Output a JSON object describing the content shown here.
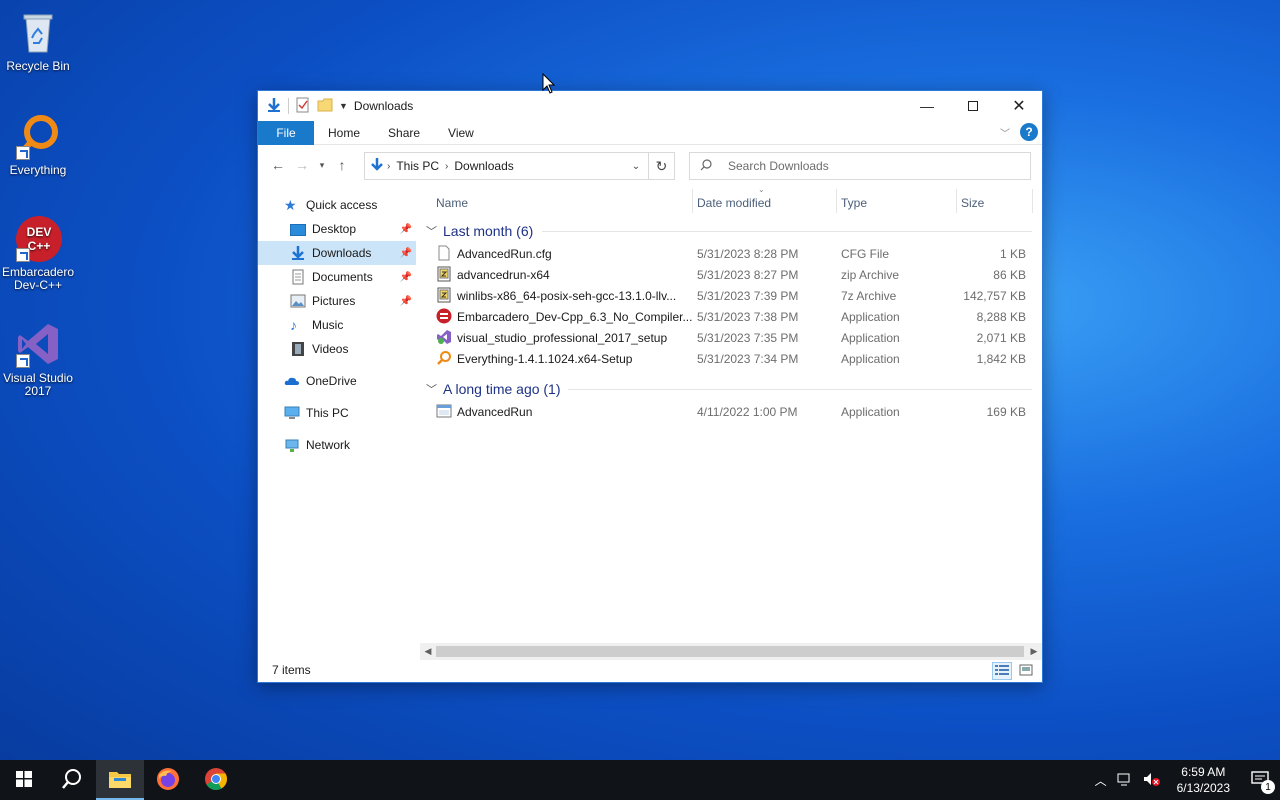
{
  "desktop": {
    "icons": [
      {
        "label": "Recycle Bin"
      },
      {
        "label": "Everything"
      },
      {
        "label": "Embarcadero Dev-C++",
        "badge_line1": "DEV",
        "badge_line2": "C++"
      },
      {
        "label": "Visual Studio 2017"
      }
    ]
  },
  "window": {
    "title": "Downloads",
    "ribbon": {
      "tabs": [
        "File",
        "Home",
        "Share",
        "View"
      ],
      "help": "?"
    },
    "address": {
      "crumbs": [
        "This PC",
        "Downloads"
      ]
    },
    "search": {
      "placeholder": "Search Downloads"
    },
    "sidebar": {
      "items": [
        {
          "label": "Quick access"
        },
        {
          "label": "Desktop"
        },
        {
          "label": "Downloads"
        },
        {
          "label": "Documents"
        },
        {
          "label": "Pictures"
        },
        {
          "label": "Music"
        },
        {
          "label": "Videos"
        },
        {
          "label": "OneDrive"
        },
        {
          "label": "This PC"
        },
        {
          "label": "Network"
        }
      ]
    },
    "columns": {
      "name": "Name",
      "date": "Date modified",
      "type": "Type",
      "size": "Size"
    },
    "groups": [
      {
        "label": "Last month (6)"
      },
      {
        "label": "A long time ago (1)"
      }
    ],
    "files": [
      {
        "name": "AdvancedRun.cfg",
        "date": "5/31/2023 8:28 PM",
        "type": "CFG File",
        "size": "1 KB"
      },
      {
        "name": "advancedrun-x64",
        "date": "5/31/2023 8:27 PM",
        "type": "zip Archive",
        "size": "86 KB"
      },
      {
        "name": "winlibs-x86_64-posix-seh-gcc-13.1.0-llv...",
        "date": "5/31/2023 7:39 PM",
        "type": "7z Archive",
        "size": "142,757 KB"
      },
      {
        "name": "Embarcadero_Dev-Cpp_6.3_No_Compiler...",
        "date": "5/31/2023 7:38 PM",
        "type": "Application",
        "size": "8,288 KB"
      },
      {
        "name": "visual_studio_professional_2017_setup",
        "date": "5/31/2023 7:35 PM",
        "type": "Application",
        "size": "2,071 KB"
      },
      {
        "name": "Everything-1.4.1.1024.x64-Setup",
        "date": "5/31/2023 7:34 PM",
        "type": "Application",
        "size": "1,842 KB"
      },
      {
        "name": "AdvancedRun",
        "date": "4/11/2022 1:00 PM",
        "type": "Application",
        "size": "169 KB"
      }
    ],
    "status": {
      "items": "7 items"
    }
  },
  "taskbar": {
    "clock": {
      "time": "6:59 AM",
      "date": "6/13/2023"
    },
    "notification_count": "1"
  },
  "colors": {
    "accent": "#1979ca",
    "selection": "#cce4f7",
    "group_text": "#1e3287"
  }
}
